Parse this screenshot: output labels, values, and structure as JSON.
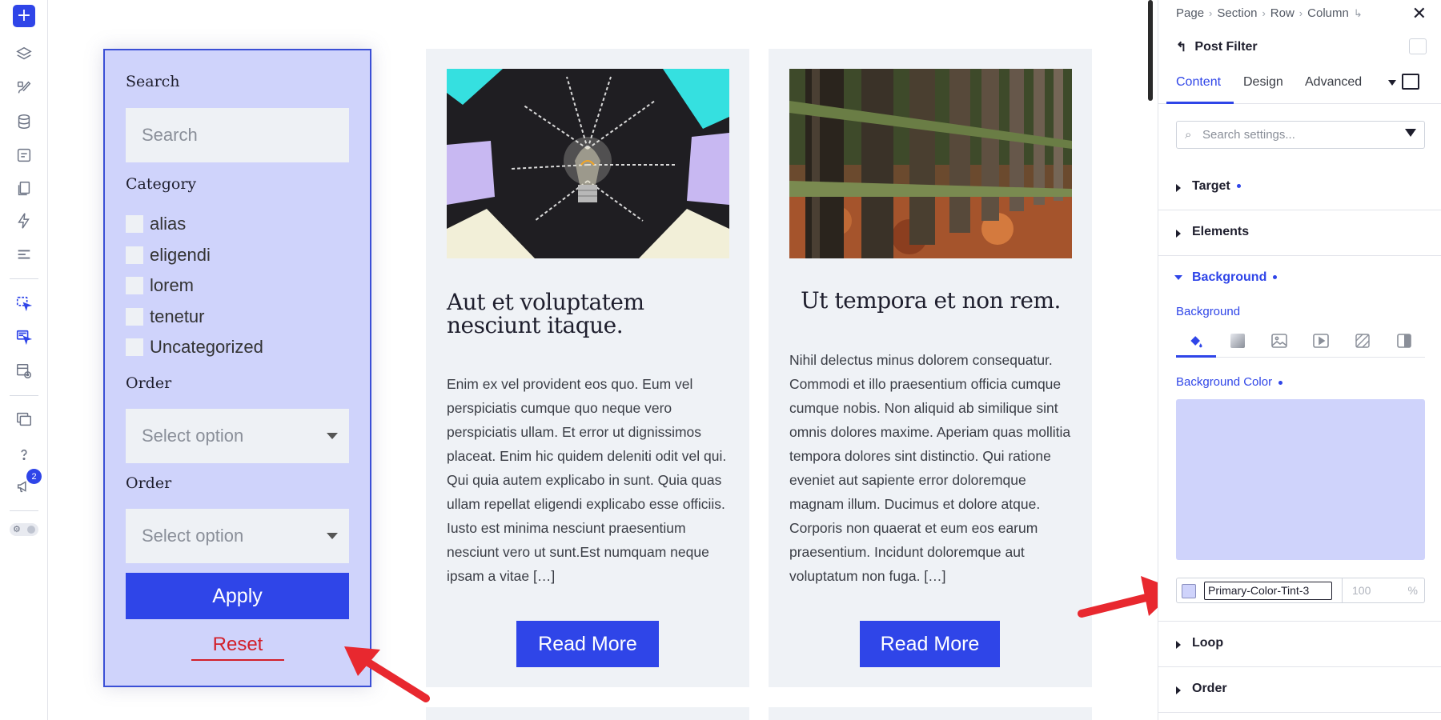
{
  "toolbar": {
    "add_label": "+",
    "badge_count": "2",
    "icons": [
      "add-icon",
      "layers-icon",
      "brush-icon",
      "database-icon",
      "form-icon",
      "pages-icon",
      "lightning-icon",
      "list-icon",
      "cursor-select-icon",
      "cursor-multi-icon",
      "template-eye-icon",
      "windows-icon",
      "help-icon",
      "announcement-icon",
      "settings-toggle-icon"
    ]
  },
  "filter": {
    "search_label": "Search",
    "search_placeholder": "Search",
    "category_label": "Category",
    "categories": [
      "alias",
      "eligendi",
      "lorem",
      "tenetur",
      "Uncategorized"
    ],
    "order1_label": "Order",
    "order1_placeholder": "Select option",
    "order2_label": "Order",
    "order2_placeholder": "Select option",
    "apply_label": "Apply",
    "reset_label": "Reset",
    "background_color": "#cfd3fb"
  },
  "posts": [
    {
      "title": "Aut et voluptatem nesciunt itaque.",
      "excerpt": "Enim ex vel provident eos quo. Eum vel perspiciatis cumque quo neque vero perspiciatis ullam. Et error ut dignissimos placeat. Enim hic quidem deleniti odit vel qui. Qui quia autem explicabo in sunt. Quia quas ullam repellat eligendi explicabo esse officiis. Iusto est minima nesciunt praesentium nesciunt vero ut sunt.Est numquam neque ipsam a vitae […]",
      "read_more": "Read More",
      "image": "lightbulb-image"
    },
    {
      "title": "Ut tempora et non rem.",
      "excerpt": "Nihil delectus minus dolorem consequatur. Commodi et illo praesentium officia cumque cumque nobis. Non aliquid ab similique sint omnis dolores maxime. Aperiam quas mollitia tempora dolores sint distinctio. Qui ratione eveniet aut sapiente error doloremque magnam illum. Ducimus et dolore atque. Corporis non quaerat et eum eos earum praesentium. Incidunt doloremque aut voluptatum non fuga. […]",
      "read_more": "Read More",
      "image": "wooden-fence-image"
    }
  ],
  "panel": {
    "breadcrumb": [
      "Page",
      "Section",
      "Row",
      "Column"
    ],
    "element_name": "Post Filter",
    "tabs": [
      "Content",
      "Design",
      "Advanced"
    ],
    "active_tab": "Content",
    "search_placeholder": "Search settings...",
    "sections": {
      "target": "Target",
      "elements": "Elements",
      "background": "Background",
      "loop": "Loop",
      "order": "Order"
    },
    "background_label": "Background",
    "background_color_label": "Background Color",
    "color_name": "Primary-Color-Tint-3",
    "opacity_placeholder": "100",
    "opacity_unit": "%",
    "accent": "#2f45e8"
  }
}
